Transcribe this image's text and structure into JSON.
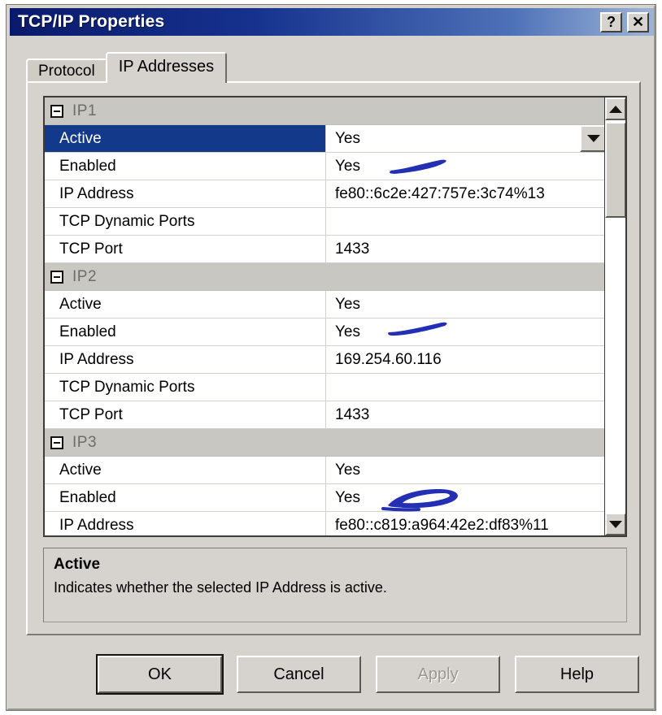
{
  "window": {
    "title": "TCP/IP Properties",
    "help_button": "?",
    "close_button": "✕"
  },
  "tabs": [
    {
      "label": "Protocol",
      "active": false
    },
    {
      "label": "IP Addresses",
      "active": true
    }
  ],
  "grid": {
    "groups": [
      {
        "label": "IP1",
        "rows": [
          {
            "name": "Active",
            "value": "Yes",
            "selected": true,
            "has_dropdown": true,
            "annotation": false
          },
          {
            "name": "Enabled",
            "value": "Yes",
            "selected": false,
            "has_dropdown": false,
            "annotation": true
          },
          {
            "name": "IP Address",
            "value": "fe80::6c2e:427:757e:3c74%13",
            "selected": false,
            "has_dropdown": false,
            "annotation": false
          },
          {
            "name": "TCP Dynamic Ports",
            "value": "",
            "selected": false,
            "has_dropdown": false,
            "annotation": false
          },
          {
            "name": "TCP Port",
            "value": "1433",
            "selected": false,
            "has_dropdown": false,
            "annotation": false
          }
        ]
      },
      {
        "label": "IP2",
        "rows": [
          {
            "name": "Active",
            "value": "Yes",
            "selected": false,
            "has_dropdown": false,
            "annotation": false
          },
          {
            "name": "Enabled",
            "value": "Yes",
            "selected": false,
            "has_dropdown": false,
            "annotation": true
          },
          {
            "name": "IP Address",
            "value": "169.254.60.116",
            "selected": false,
            "has_dropdown": false,
            "annotation": false
          },
          {
            "name": "TCP Dynamic Ports",
            "value": "",
            "selected": false,
            "has_dropdown": false,
            "annotation": false
          },
          {
            "name": "TCP Port",
            "value": "1433",
            "selected": false,
            "has_dropdown": false,
            "annotation": false
          }
        ]
      },
      {
        "label": "IP3",
        "rows": [
          {
            "name": "Active",
            "value": "Yes",
            "selected": false,
            "has_dropdown": false,
            "annotation": false
          },
          {
            "name": "Enabled",
            "value": "Yes",
            "selected": false,
            "has_dropdown": false,
            "annotation": true
          },
          {
            "name": "IP Address",
            "value": "fe80::c819:a964:42e2:df83%11",
            "selected": false,
            "has_dropdown": true,
            "annotation": false
          }
        ]
      }
    ]
  },
  "description": {
    "title": "Active",
    "body": "Indicates whether the selected IP Address is active."
  },
  "buttons": [
    {
      "label": "OK",
      "default": true,
      "disabled": false
    },
    {
      "label": "Cancel",
      "default": false,
      "disabled": false
    },
    {
      "label": "Apply",
      "default": false,
      "disabled": true
    },
    {
      "label": "Help",
      "default": false,
      "disabled": false
    }
  ],
  "colors": {
    "titlebar_start": "#0a1a6b",
    "titlebar_end": "#9db4d6",
    "selection": "#133a8a",
    "dialog_face": "#d6d3ce",
    "group_header": "#c9c7c1",
    "annotation_ink": "#2430b4"
  }
}
